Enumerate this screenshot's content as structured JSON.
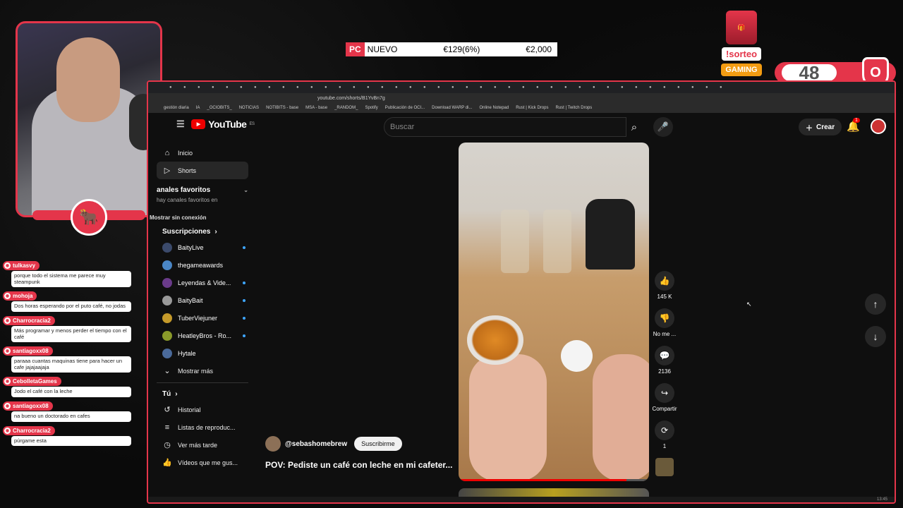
{
  "overlay": {
    "ticker": {
      "tag": "PC",
      "label": "NUEVO",
      "price": "€129(6%)",
      "old_price": "€2,000"
    },
    "giveaway": {
      "command": "!sorteo",
      "brand": "GAMING"
    },
    "counter": "48"
  },
  "browser": {
    "url": "youtube.com/shorts/B1YvBn7g",
    "bookmarks": [
      "gestión diaria",
      "IA",
      "_OCIOBITS_",
      "NOTICIAS",
      "NOTIBITS - base",
      "MSA - base",
      "_RANDOM_",
      "Spotify",
      "Publicación de OCI...",
      "Download WARP di...",
      "Online Notepad",
      "Rust | Kick Drops",
      "Rust | Twitch Drops"
    ]
  },
  "youtube": {
    "logo": "YouTube",
    "logo_region": "ES",
    "search_placeholder": "Buscar",
    "create_label": "Crear",
    "notifications": "1",
    "sidebar": {
      "home": "Inicio",
      "shorts": "Shorts",
      "favorites_title": "anales favoritos",
      "favorites_empty": "hay canales favoritos en",
      "offline": "Mostrar sin conexión",
      "subs_title": "Suscripciones",
      "channels": [
        {
          "name": "BaityLive",
          "color": "#3b4a6b",
          "live": true
        },
        {
          "name": "thegameawards",
          "color": "#4a86c5",
          "live": false
        },
        {
          "name": "Leyendas & Vide...",
          "color": "#6a3b8a",
          "live": true
        },
        {
          "name": "BaityBait",
          "color": "#999999",
          "live": true
        },
        {
          "name": "TuberViejuner",
          "color": "#c59a2a",
          "live": true
        },
        {
          "name": "HeatleyBros - Ro...",
          "color": "#8a9a2a",
          "live": true
        },
        {
          "name": "Hytale",
          "color": "#4a6a9a",
          "live": false
        }
      ],
      "show_more": "Mostrar más",
      "you_title": "Tú",
      "history": "Historial",
      "playlists": "Listas de reproduc...",
      "watch_later": "Ver más tarde",
      "liked": "Vídeos que me gus..."
    },
    "short": {
      "channel": "@sebashomebrew",
      "subscribe": "Suscribirme",
      "title": "POV: Pediste un café con leche en mi cafeter...",
      "likes": "145 K",
      "dislike_label": "No me ...",
      "comments": "2136",
      "share_label": "Compartir",
      "remix_count": "1",
      "progress": 0.88
    }
  },
  "chat": [
    {
      "user": "tulkasvy",
      "text": "porque todo el sistema me parece muy steampunk"
    },
    {
      "user": "mohoja",
      "text": "Dos horas esperando por el puto café, no jodas"
    },
    {
      "user": "Charrocracia2",
      "text": "Más programar y menos perder el tiempo con el café"
    },
    {
      "user": "santiagoxx08",
      "text": "paraaa cuantas maquinas tiene para hacer un cafe jajajaajaja"
    },
    {
      "user": "CebolletaGames",
      "text": "Jodo el café con la leche"
    },
    {
      "user": "santiagoxx08",
      "text": "na bueno un doctorado en cafes"
    },
    {
      "user": "Charrocracia2",
      "text": "púrgame esta"
    }
  ],
  "taskbar": {
    "time": "13:45"
  }
}
